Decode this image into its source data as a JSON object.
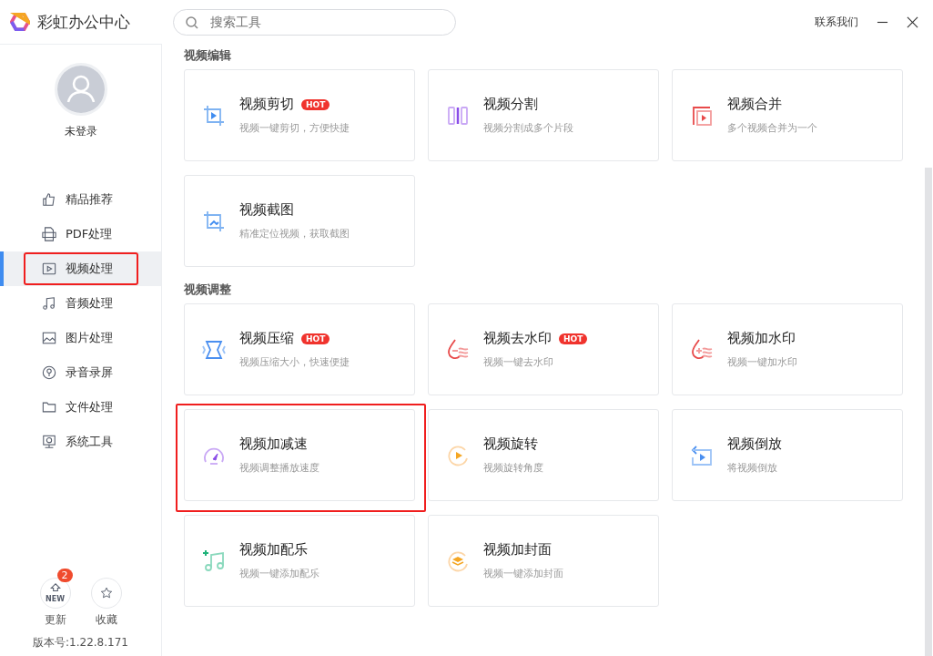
{
  "app": {
    "title": "彩虹办公中心",
    "search": {
      "placeholder": "搜索工具"
    },
    "contact": "联系我们"
  },
  "user": {
    "name": "未登录"
  },
  "sidebar": {
    "items": [
      {
        "kind": "thumb",
        "label": "精品推荐",
        "selected": false,
        "highlighted": false
      },
      {
        "kind": "pdf",
        "label": "PDF处理",
        "selected": false,
        "highlighted": false
      },
      {
        "kind": "video",
        "label": "视频处理",
        "selected": true,
        "highlighted": true
      },
      {
        "kind": "music",
        "label": "音频处理",
        "selected": false,
        "highlighted": false
      },
      {
        "kind": "image",
        "label": "图片处理",
        "selected": false,
        "highlighted": false
      },
      {
        "kind": "mic",
        "label": "录音录屏",
        "selected": false,
        "highlighted": false
      },
      {
        "kind": "folder",
        "label": "文件处理",
        "selected": false,
        "highlighted": false
      },
      {
        "kind": "monitor",
        "label": "系统工具",
        "selected": false,
        "highlighted": false
      }
    ],
    "footer": [
      {
        "kind": "update",
        "label": "更新",
        "badge": "2",
        "icon_text": "NEW"
      },
      {
        "kind": "star",
        "label": "收藏"
      }
    ],
    "version": "版本号:1.22.8.171"
  },
  "sections": [
    {
      "title": "视频编辑",
      "cards": [
        {
          "kind": "crop",
          "title": "视频剪切",
          "desc": "视频一键剪切，方便快捷",
          "hot": "HOT",
          "highlighted": false
        },
        {
          "kind": "split",
          "title": "视频分割",
          "desc": "视频分割成多个片段",
          "highlighted": false
        },
        {
          "kind": "merge",
          "title": "视频合并",
          "desc": "多个视频合并为一个",
          "highlighted": false
        },
        {
          "kind": "snapshot",
          "title": "视频截图",
          "desc": "精准定位视频，获取截图",
          "highlighted": false
        }
      ]
    },
    {
      "title": "视频调整",
      "cards": [
        {
          "kind": "compress",
          "title": "视频压缩",
          "desc": "视频压缩大小，快速便捷",
          "hot": "HOT",
          "highlighted": false
        },
        {
          "kind": "unmark",
          "title": "视频去水印",
          "desc": "视频一键去水印",
          "hot": "HOT",
          "highlighted": false
        },
        {
          "kind": "addmark",
          "title": "视频加水印",
          "desc": "视频一键加水印",
          "highlighted": false
        },
        {
          "kind": "speed",
          "title": "视频加减速",
          "desc": "视频调整播放速度",
          "highlighted": true
        },
        {
          "kind": "rotate",
          "title": "视频旋转",
          "desc": "视频旋转角度",
          "highlighted": false
        },
        {
          "kind": "reverse",
          "title": "视频倒放",
          "desc": "将视频倒放",
          "highlighted": false
        },
        {
          "kind": "music",
          "title": "视频加配乐",
          "desc": "视频一键添加配乐",
          "highlighted": false
        },
        {
          "kind": "cover",
          "title": "视频加封面",
          "desc": "视频一键添加封面",
          "highlighted": false
        }
      ]
    }
  ]
}
